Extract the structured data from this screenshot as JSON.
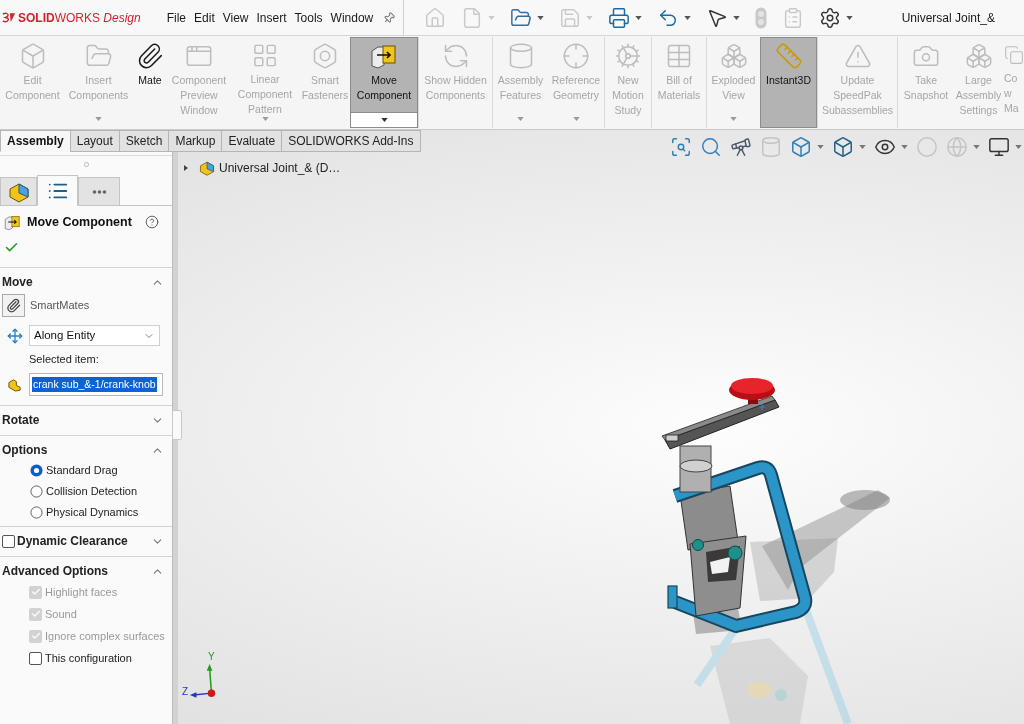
{
  "title_bar": {
    "logo": "**SOLID**WORKS *Design*",
    "menu": [
      "File",
      "Edit",
      "View",
      "Insert",
      "Tools",
      "Window"
    ],
    "quick_access": [
      {
        "kind": "home",
        "disabled": true,
        "dropdown": false
      },
      {
        "kind": "new",
        "disabled": true,
        "dropdown": true
      },
      {
        "kind": "open",
        "disabled": false,
        "dropdown": true
      },
      {
        "kind": "save",
        "disabled": true,
        "dropdown": true
      },
      {
        "kind": "print",
        "disabled": false,
        "dropdown": true
      },
      {
        "kind": "undo",
        "disabled": false,
        "dropdown": true
      },
      {
        "kind": "select",
        "disabled": false,
        "dropdown": true
      },
      {
        "kind": "rebuild",
        "disabled": true,
        "dropdown": false
      },
      {
        "kind": "file-properties",
        "disabled": true,
        "dropdown": false
      },
      {
        "kind": "options",
        "disabled": false,
        "dropdown": true
      }
    ],
    "document_title": "Universal Joint_&"
  },
  "ribbon": {
    "groups": [
      {
        "items": [
          {
            "kind": "edit-component",
            "label": "Edit Component",
            "disabled": true,
            "selected": false,
            "dropdown": false
          },
          {
            "kind": "insert-components",
            "label": "Insert Components",
            "disabled": true,
            "selected": false,
            "dropdown": true
          },
          {
            "kind": "mate",
            "label": "Mate",
            "disabled": false,
            "selected": false,
            "dropdown": false
          },
          {
            "kind": "preview-window",
            "label": "Component Preview Window",
            "disabled": true,
            "selected": false,
            "dropdown": false
          },
          {
            "kind": "linear-pattern",
            "label": "Linear Component Pattern",
            "disabled": true,
            "selected": false,
            "dropdown": true
          },
          {
            "kind": "smart-fasteners",
            "label": "Smart Fasteners",
            "disabled": true,
            "selected": false,
            "dropdown": false
          },
          {
            "kind": "move-component",
            "label": "Move Component",
            "disabled": false,
            "selected": true,
            "dropdown": true
          }
        ]
      },
      {
        "items": [
          {
            "kind": "show-hidden",
            "label": "Show Hidden Components",
            "disabled": true,
            "selected": false,
            "dropdown": false
          }
        ]
      },
      {
        "items": [
          {
            "kind": "assembly-features",
            "label": "Assembly Features",
            "disabled": true,
            "selected": false,
            "dropdown": true
          },
          {
            "kind": "reference-geometry",
            "label": "Reference Geometry",
            "disabled": true,
            "selected": false,
            "dropdown": true
          }
        ]
      },
      {
        "items": [
          {
            "kind": "motion-study",
            "label": "New Motion Study",
            "disabled": true,
            "selected": false,
            "dropdown": false
          }
        ]
      },
      {
        "items": [
          {
            "kind": "bom",
            "label": "Bill of Materials",
            "disabled": true,
            "selected": false,
            "dropdown": false
          }
        ]
      },
      {
        "items": [
          {
            "kind": "exploded-view",
            "label": "Exploded View",
            "disabled": true,
            "selected": false,
            "dropdown": true
          },
          {
            "kind": "instant3d",
            "label": "Instant3D",
            "disabled": false,
            "selected": true,
            "dropdown": false
          }
        ]
      },
      {
        "items": [
          {
            "kind": "speedpak",
            "label": "Update SpeedPak Subassemblies",
            "disabled": true,
            "selected": false,
            "dropdown": false
          }
        ]
      },
      {
        "items": [
          {
            "kind": "snapshot",
            "label": "Take Snapshot",
            "disabled": true,
            "selected": false,
            "dropdown": false
          },
          {
            "kind": "large-assembly",
            "label": "Large Assembly Settings",
            "disabled": true,
            "selected": false,
            "dropdown": false
          },
          {
            "kind": "copy-with-mates",
            "label": "Co w Ma",
            "disabled": true,
            "selected": false,
            "dropdown": false
          }
        ]
      }
    ]
  },
  "command_tabs": [
    {
      "label": "Assembly",
      "selected": true
    },
    {
      "label": "Layout",
      "selected": false
    },
    {
      "label": "Sketch",
      "selected": false
    },
    {
      "label": "Markup",
      "selected": false
    },
    {
      "label": "Evaluate",
      "selected": false
    },
    {
      "label": "SOLIDWORKS Add-Ins",
      "selected": false
    }
  ],
  "view_toolbar": [
    {
      "kind": "zoom-fit",
      "disabled": false,
      "dropdown": false
    },
    {
      "kind": "zoom-area",
      "disabled": false,
      "dropdown": false
    },
    {
      "kind": "previous-view",
      "disabled": false,
      "dropdown": false
    },
    {
      "kind": "section-view",
      "disabled": true,
      "dropdown": false
    },
    {
      "kind": "view-orientation",
      "disabled": false,
      "dropdown": true
    },
    {
      "kind": "display-style",
      "disabled": false,
      "dropdown": true
    },
    {
      "kind": "hide-show",
      "disabled": false,
      "dropdown": true
    },
    {
      "kind": "edit-appearance",
      "disabled": true,
      "dropdown": false
    },
    {
      "kind": "apply-scene",
      "disabled": true,
      "dropdown": true
    },
    {
      "kind": "view-settings",
      "disabled": false,
      "dropdown": true
    }
  ],
  "property_manager": {
    "tabs": [
      {
        "kind": "feature-tree",
        "selected": false
      },
      {
        "kind": "property-manager",
        "selected": true
      },
      {
        "kind": "more",
        "selected": false
      }
    ],
    "title": "Move Component",
    "sections": [
      {
        "kind": "move",
        "title": "Move",
        "expanded": true,
        "smartmates": "SmartMates",
        "mode": "Along Entity",
        "selected_item_label": "Selected item:",
        "selected_item": "crank sub_&-1/crank-knob",
        "selected_item_highlighted": true
      },
      {
        "kind": "plain",
        "title": "Rotate",
        "expanded": false
      },
      {
        "kind": "radios",
        "title": "Options",
        "expanded": true,
        "options": [
          {
            "label": "Standard Drag",
            "selected": true
          },
          {
            "label": "Collision Detection",
            "selected": false
          },
          {
            "label": "Physical Dynamics",
            "selected": false
          }
        ]
      },
      {
        "kind": "checkbox-header",
        "title": "Dynamic Clearance",
        "expanded": false,
        "checked": false
      },
      {
        "kind": "checks",
        "title": "Advanced Options",
        "expanded": true,
        "options": [
          {
            "label": "Highlight faces",
            "checked": true,
            "disabled": true
          },
          {
            "label": "Sound",
            "checked": true,
            "disabled": true
          },
          {
            "label": "Ignore complex surfaces",
            "checked": true,
            "disabled": true
          },
          {
            "label": "This configuration",
            "checked": false,
            "disabled": false
          }
        ]
      }
    ]
  },
  "viewport": {
    "tree_root": {
      "label": "Universal Joint_& (D…",
      "expanded": false
    },
    "triad_labels": [
      "Y",
      "Z"
    ]
  }
}
